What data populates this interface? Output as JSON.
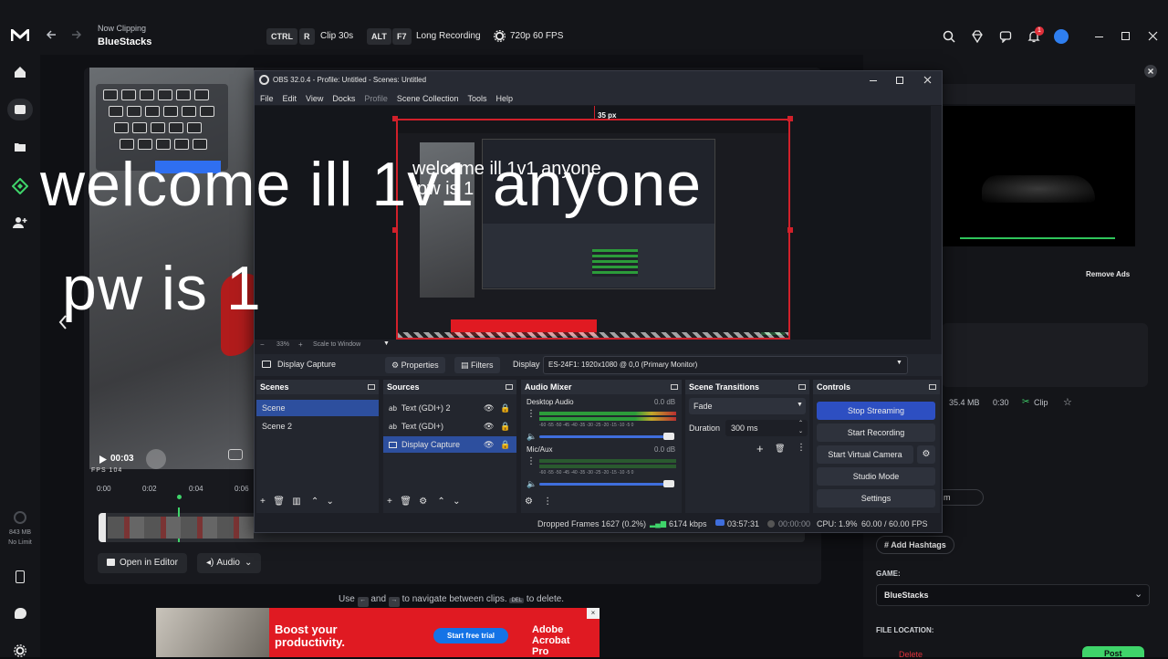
{
  "medal": {
    "now_clipping_label": "Now Clipping",
    "app_name": "BlueStacks",
    "hotkeys": [
      {
        "mod": "CTRL",
        "key": "R",
        "action": "Clip 30s"
      },
      {
        "mod": "ALT",
        "key": "F7",
        "action": "Long Recording"
      }
    ],
    "quality": "720p 60 FPS",
    "notification_count": "1",
    "storage": "843 MB",
    "storage_limit": "No Limit"
  },
  "overlay_text": {
    "line1": "welcome ill 1v1 anyone",
    "line2": "pw is 1"
  },
  "clip_player": {
    "time": "00:03",
    "fps_label": "FPS 104",
    "ticks": [
      "0:00",
      "0:02",
      "0:04",
      "0:06"
    ],
    "open_editor": "Open in Editor",
    "audio": "Audio",
    "nav_hint_pre": "Use",
    "nav_hint_and": "and",
    "nav_hint_post": "to navigate between clips.",
    "del_key": "DEL",
    "del_hint": "to delete."
  },
  "ad_banner": {
    "headline": "Boost your productivity.",
    "cta": "Start free trial",
    "brand": "Adobe Acrobat Pro"
  },
  "right_panel": {
    "remove_ads": "Remove Ads",
    "file_size": "35.4 MB",
    "duration": "0:30",
    "clip_label": "Clip",
    "add_hashtags": "Add Hashtags",
    "game_label": "GAME:",
    "game_value": "BlueStacks",
    "file_location_label": "FILE LOCATION:",
    "delete_label": "Delete",
    "post_label": "Post",
    "partial_m": "m"
  },
  "obs": {
    "title": "OBS 32.0.4 - Profile: Untitled - Scenes: Untitled",
    "menu": [
      "File",
      "Edit",
      "View",
      "Docks",
      "Profile",
      "Scene Collection",
      "Tools",
      "Help"
    ],
    "px_label": "35 px",
    "zoom": "33%",
    "scale_mode": "Scale to Window",
    "source_name": "Display Capture",
    "properties": "Properties",
    "filters": "Filters",
    "display_label": "Display",
    "display_value": "ES-24F1: 1920x1080 @ 0,0 (Primary Monitor)",
    "scenes_title": "Scenes",
    "scenes": [
      "Scene",
      "Scene 2"
    ],
    "sources_title": "Sources",
    "sources": [
      "Text (GDI+) 2",
      "Text (GDI+)",
      "Display Capture"
    ],
    "mixer_title": "Audio Mixer",
    "mixer": [
      {
        "name": "Desktop Audio",
        "db": "0.0 dB",
        "level": 0.8
      },
      {
        "name": "Mic/Aux",
        "db": "0.0 dB",
        "level": 0.0
      }
    ],
    "meter_scale": "-60 -55 -50 -45 -40 -35 -30 -25 -20 -15 -10 -5 0",
    "transitions_title": "Scene Transitions",
    "transition": "Fade",
    "duration_label": "Duration",
    "duration_value": "300 ms",
    "controls_title": "Controls",
    "controls": [
      "Stop Streaming",
      "Start Recording",
      "Start Virtual Camera",
      "Studio Mode",
      "Settings"
    ],
    "status": {
      "dropped": "Dropped Frames 1627 (0.2%)",
      "bitrate": "6174 kbps",
      "stream_time": "03:57:31",
      "rec_time": "00:00:00",
      "cpu": "CPU: 1.9%",
      "fps": "60.00 / 60.00 FPS"
    }
  },
  "colors": {
    "medal_bg": "#141519",
    "obs_bg": "#1d1f26",
    "accent_blue": "#2d4f9e",
    "ad_red": "#e01a22",
    "medal_green": "#3fd46a"
  }
}
